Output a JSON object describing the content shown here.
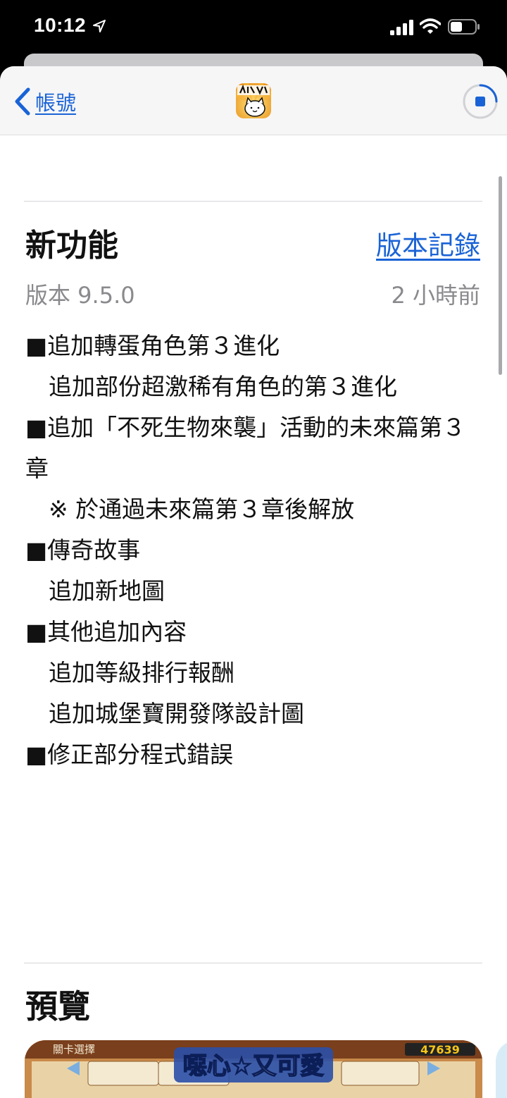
{
  "status_bar": {
    "time": "10:12"
  },
  "navbar": {
    "back_label": "帳號",
    "app_icon": "battle-cats-app-icon"
  },
  "whats_new": {
    "title": "新功能",
    "history_link": "版本記錄",
    "version": "版本 9.5.0",
    "time_ago": "2 小時前",
    "lines": [
      "■追加轉蛋角色第３進化",
      "　追加部份超激稀有角色的第３進化",
      "",
      "■追加「不死生物來襲」活動的未來篇第３章",
      "　※ 於通過未來篇第３章後解放",
      "",
      "■傳奇故事",
      "　追加新地圖",
      "",
      "■其他追加內容",
      "　追加等級排行報酬",
      "　追加城堡寶開發隊設計圖",
      "",
      "■修正部分程式錯誤"
    ]
  },
  "preview": {
    "title": "預覽",
    "screenshot_caption": "噁心☆又可愛",
    "screenshot_header": "關卡選擇",
    "screenshot_xp": "47639"
  },
  "colors": {
    "accent": "#1a63d6",
    "secondary_text": "#8a8a8e"
  }
}
